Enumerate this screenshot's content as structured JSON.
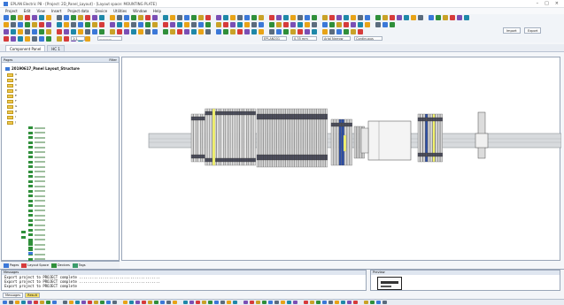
{
  "window": {
    "title": "EPLAN Electric P8 - [Project: 2D_Panel_Layout] - [Layout space: MOUNTING PLATE]",
    "controls": [
      "–",
      "□",
      "×"
    ]
  },
  "menu": [
    "Project",
    "Edit",
    "View",
    "Insert",
    "Project data",
    "Device",
    "Utilities",
    "Window",
    "Help"
  ],
  "toolbar": {
    "combo_scale": "1:1",
    "combo_line": "————",
    "combo_layer": "EPLAN201",
    "combo_width": "0.35 mm",
    "combo_font": "Arial Narrow",
    "combo_style": "Continuous",
    "import_label": "Import",
    "export_label": "Export"
  },
  "tabs": {
    "tab1": "Component Panel",
    "tab2": "HC 1"
  },
  "left_pane": {
    "title": "Pages",
    "filter_label": "Filter",
    "root": "20190617_Panel Layout_Structure",
    "folders": [
      "A",
      "B",
      "C",
      "D",
      "E",
      "F",
      "G",
      "H",
      "I",
      "J"
    ]
  },
  "left_tabs": [
    "Pages",
    "Layout Space",
    "Devices",
    "Tags"
  ],
  "messages": {
    "title": "Messages",
    "lines": [
      "Export project to PROJECT complete ......................................",
      "Export project to PROJECT complete ......................................",
      "Export project to PROJECT complete"
    ]
  },
  "message_tabs": [
    "Messages",
    "Result"
  ],
  "preview": {
    "title": "Preview"
  },
  "colors": {
    "accent": "#3b78d8",
    "folder": "#f0c84c",
    "device_green": "#2f8f3a",
    "terminal_dark": "#4d4f5f",
    "din_rail": "#b7bcc2",
    "highlight_yellow": "#f3f36b",
    "highlight_blue": "#2c4ea8"
  },
  "icons": [
    "new-icon",
    "open-icon",
    "save-icon",
    "print-icon",
    "undo-icon",
    "redo-icon",
    "zoom-icon",
    "settings-icon"
  ]
}
